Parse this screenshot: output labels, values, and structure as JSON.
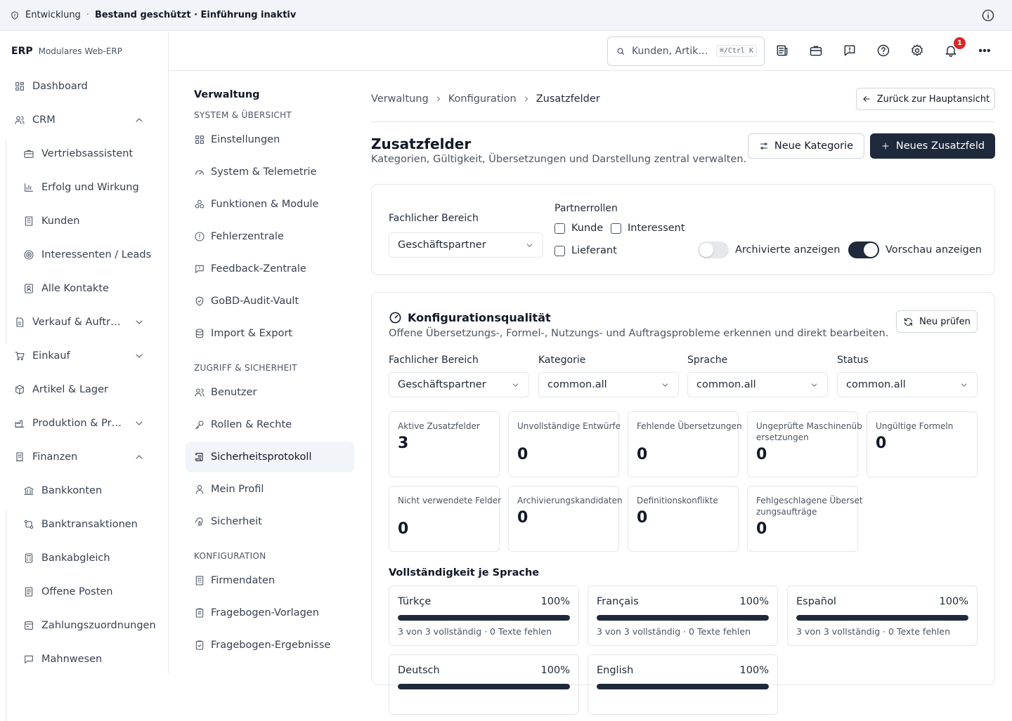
{
  "topbar": {
    "env": "Entwicklung",
    "separator": "·",
    "status": "Bestand geschützt · Einführung inaktiv"
  },
  "brand": {
    "name": "ERP",
    "tagline": "Modulares Web-ERP"
  },
  "sidebar": {
    "items": [
      {
        "label": "Dashboard",
        "icon": "dashboard-icon"
      },
      {
        "label": "CRM",
        "icon": "users-icon",
        "expanded": true
      },
      {
        "label": "Vertriebsassistent",
        "icon": "briefcase-icon"
      },
      {
        "label": "Erfolg und Wirkung",
        "icon": "chart-icon"
      },
      {
        "label": "Kunden",
        "icon": "building-icon"
      },
      {
        "label": "Interessenten / Leads",
        "icon": "target-icon"
      },
      {
        "label": "Alle Kontakte",
        "icon": "contact-icon"
      },
      {
        "label": "Verkauf & Auftr…",
        "icon": "document-icon"
      },
      {
        "label": "Einkauf",
        "icon": "cart-icon"
      },
      {
        "label": "Artikel & Lager",
        "icon": "package-icon"
      },
      {
        "label": "Produktion & Pr…",
        "icon": "factory-icon"
      },
      {
        "label": "Finanzen",
        "icon": "receipt-icon",
        "expanded": true
      },
      {
        "label": "Bankkonten",
        "icon": "bank-icon"
      },
      {
        "label": "Banktransaktionen",
        "icon": "transfer-icon"
      },
      {
        "label": "Bankabgleich",
        "icon": "calculator-icon"
      },
      {
        "label": "Offene Posten",
        "icon": "file-icon"
      },
      {
        "label": "Zahlungszuordnungen",
        "icon": "card-icon"
      },
      {
        "label": "Mahnwesen",
        "icon": "message-icon"
      }
    ]
  },
  "header": {
    "search_placeholder": "Kunden, Artik…",
    "search_shortcut": "⌘/Ctrl K",
    "notifications": "1"
  },
  "settings_nav": {
    "title": "Verwaltung",
    "sections": [
      "SYSTEM & ÜBERSICHT",
      "ZUGRIFF & SICHERHEIT",
      "KONFIGURATION"
    ],
    "items": [
      {
        "label": "Einstellungen"
      },
      {
        "label": "System & Telemetrie"
      },
      {
        "label": "Funktionen & Module"
      },
      {
        "label": "Fehlerzentrale"
      },
      {
        "label": "Feedback-Zentrale"
      },
      {
        "label": "GoBD-Audit-Vault"
      },
      {
        "label": "Import & Export"
      },
      {
        "label": "Benutzer"
      },
      {
        "label": "Rollen & Rechte"
      },
      {
        "label": "Sicherheitsprotokoll"
      },
      {
        "label": "Mein Profil"
      },
      {
        "label": "Sicherheit"
      },
      {
        "label": "Firmendaten"
      },
      {
        "label": "Fragebogen-Vorlagen"
      },
      {
        "label": "Fragebogen-Ergebnisse"
      }
    ]
  },
  "breadcrumb": [
    "Verwaltung",
    "Konfiguration",
    "Zusatzfelder"
  ],
  "page": {
    "back_label": "Zurück zur Hauptansicht",
    "title": "Zusatzfelder",
    "subtitle": "Kategorien, Gültigkeit, Übersetzungen und Darstellung zentral verwalten.",
    "new_category": "Neue Kategorie",
    "new_field": "Neues Zusatzfeld"
  },
  "filters": {
    "area_label": "Fachlicher Bereich",
    "area_value": "Geschäftspartner",
    "roles_label": "Partnerrollen",
    "role_customer": "Kunde",
    "role_prospect": "Interessent",
    "role_supplier": "Lieferant",
    "archived_label": "Archivierte anzeigen",
    "archived_on": false,
    "preview_label": "Vorschau anzeigen",
    "preview_on": true
  },
  "quality": {
    "title": "Konfigurationsqualität",
    "subtitle": "Offene Übersetzungs-, Formel-, Nutzungs- und Auftragsprobleme erkennen und direkt bearbeiten.",
    "recheck": "Neu prüfen",
    "filter_area_label": "Fachlicher Bereich",
    "filter_area_value": "Geschäftspartner",
    "filter_category_label": "Kategorie",
    "filter_category_value": "common.all",
    "filter_language_label": "Sprache",
    "filter_language_value": "common.all",
    "filter_status_label": "Status",
    "filter_status_value": "common.all",
    "metrics": [
      {
        "label": "Aktive Zusatzfelder",
        "value": "3"
      },
      {
        "label": "Unvollständige Entwürfe",
        "value": "0"
      },
      {
        "label": "Fehlende Übersetzungen",
        "value": "0"
      },
      {
        "label": "Ungeprüfte Maschinenübersetzungen",
        "value": "0"
      },
      {
        "label": "Ungültige Formeln",
        "value": "0"
      },
      {
        "label": "Nicht verwendete Felder",
        "value": "0"
      },
      {
        "label": "Archivierungskandidaten",
        "value": "0"
      },
      {
        "label": "Definitionskonflikte",
        "value": "0"
      },
      {
        "label": "Fehlgeschlagene Übersetzungsaufträge",
        "value": "0"
      }
    ],
    "completeness_title": "Vollständigkeit je Sprache",
    "languages": [
      {
        "name": "Türkçe",
        "percent_label": "100%",
        "percent": 100,
        "summary": "3 von 3 vollständig · 0 Texte fehlen"
      },
      {
        "name": "Français",
        "percent_label": "100%",
        "percent": 100,
        "summary": "3 von 3 vollständig · 0 Texte fehlen"
      },
      {
        "name": "Español",
        "percent_label": "100%",
        "percent": 100,
        "summary": "3 von 3 vollständig · 0 Texte fehlen"
      },
      {
        "name": "Deutsch",
        "percent_label": "100%",
        "percent": 100,
        "summary": ""
      },
      {
        "name": "English",
        "percent_label": "100%",
        "percent": 100,
        "summary": ""
      }
    ]
  },
  "colors": {
    "primary": "#1e293b",
    "toggle_off": "#e5e7eb",
    "badge": "#dc2626"
  }
}
